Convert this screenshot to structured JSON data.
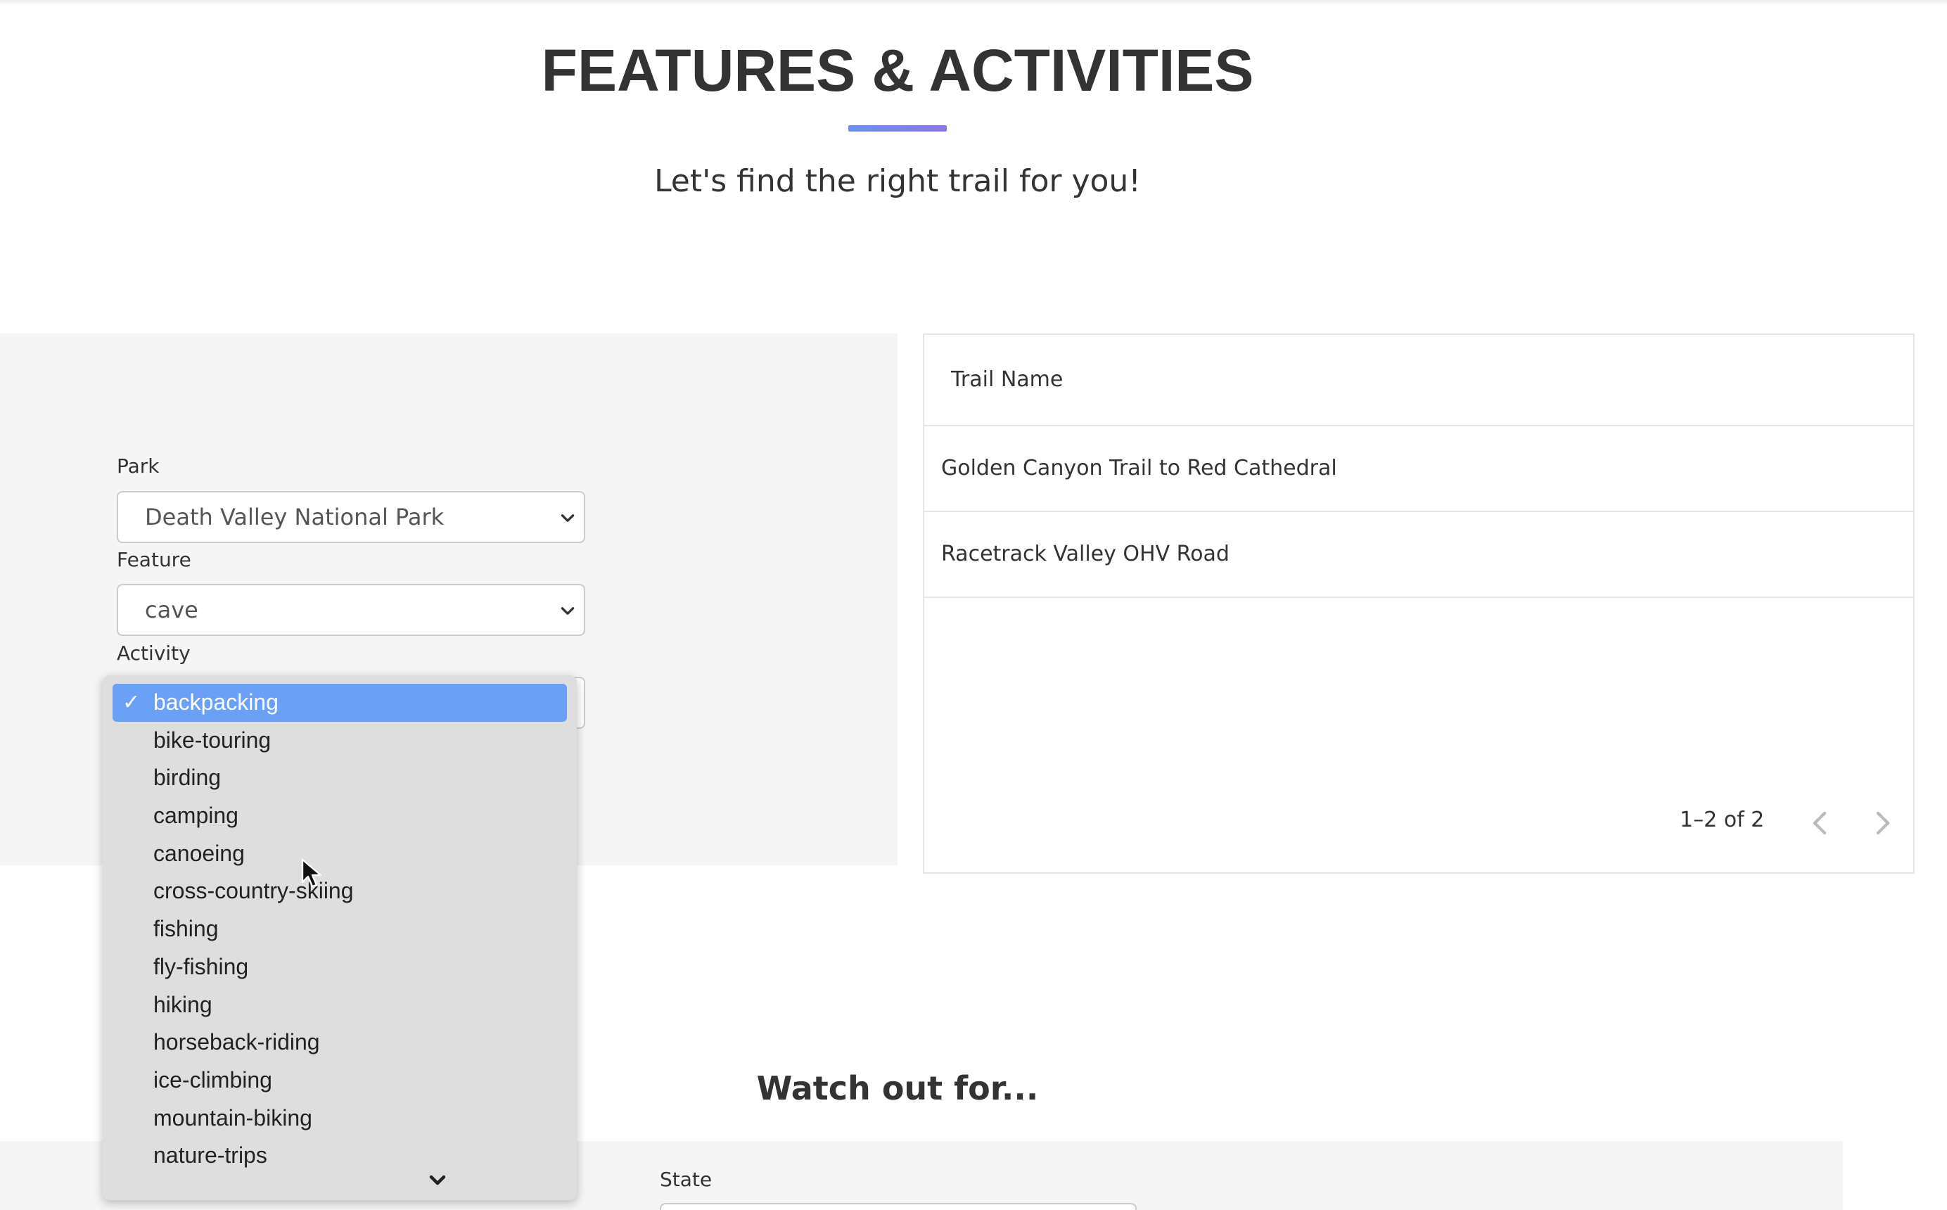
{
  "header": {
    "title": "FEATURES & ACTIVITIES",
    "subtitle": "Let's find the right trail for you!"
  },
  "filters": {
    "park": {
      "label": "Park",
      "value": "Death Valley National Park"
    },
    "feature": {
      "label": "Feature",
      "value": "cave"
    },
    "activity": {
      "label": "Activity",
      "options": [
        "backpacking",
        "bike-touring",
        "birding",
        "camping",
        "canoeing",
        "cross-country-skiing",
        "fishing",
        "fly-fishing",
        "hiking",
        "horseback-riding",
        "ice-climbing",
        "mountain-biking",
        "nature-trips"
      ],
      "selected": "backpacking"
    }
  },
  "results": {
    "column_header": "Trail Name",
    "rows": [
      "Golden Canyon Trail to Red Cathedral",
      "Racetrack Valley OHV Road"
    ],
    "pagination": "1–2 of 2"
  },
  "watch_out": {
    "title": "Watch out for...",
    "state_label": "State"
  },
  "colors": {
    "accent": "#6aa1f7",
    "panel_bg": "#f5f5f5",
    "underline_start": "#6a8ff2",
    "underline_end": "#8a76e8"
  },
  "icons": {
    "select_arrow": "chevron-down-icon",
    "selected_mark": "check-icon",
    "prev_page": "chevron-left-icon",
    "next_page": "chevron-right-icon",
    "cursor": "mouse-pointer-icon"
  }
}
